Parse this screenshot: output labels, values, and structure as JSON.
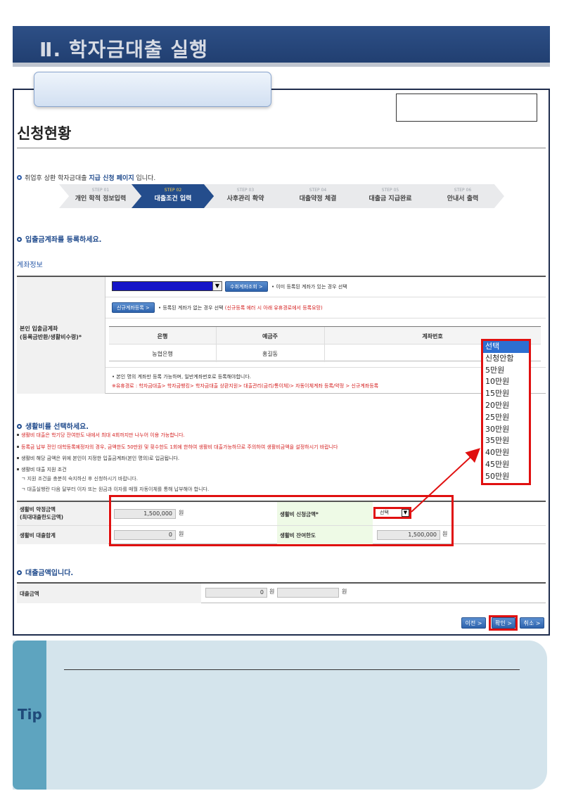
{
  "banner": {
    "title": "Ⅱ. 학자금대출 실행"
  },
  "page_title": "신청현황",
  "notice": {
    "prefix": "취업후 상환 학자금대출 ",
    "bold": "지급 신청 페이지",
    "suffix": " 입니다."
  },
  "steps": [
    {
      "num": "STEP 01",
      "label": "개인 학적 정보입력"
    },
    {
      "num": "STEP 02",
      "label": "대출조건 입력"
    },
    {
      "num": "STEP 03",
      "label": "사후관리 확약"
    },
    {
      "num": "STEP 04",
      "label": "대출약정 체결"
    },
    {
      "num": "STEP 05",
      "label": "대출금 지급완료"
    },
    {
      "num": "STEP 06",
      "label": "안내서 출력"
    }
  ],
  "account_section": {
    "heading": "입출금계좌를 등록하세요.",
    "subheading": "계좌정보",
    "row_label": "본인 입출금계좌\n(등록금반환/생활비수령)*",
    "lookup_button": "수취계좌조회 >",
    "lookup_note": "• 이미 등록된 계좌가 있는 경우 선택",
    "new_button": "신규계좌등록 >",
    "new_note_prefix": "• 등록된 계좌가 없는 경우 선택 ",
    "new_note_red": "(신규등록 에러 시 아래 유휴경로에서 등록요망)",
    "bank_table": {
      "headers": [
        "은행",
        "예금주",
        "계좌번호"
      ],
      "row": [
        "농협은행",
        "홍길동",
        ""
      ]
    },
    "foot_note": "• 본인 명의 계좌만 등록 가능하며, 일반계좌번호로 등록해야합니다.",
    "foot_note_red": "※유휴경로 : 학자금대출> 학자금뱅킹> 학자금대출 상환지원> 대출관리(금리/통이체)> 자동이체계좌 등록/약정 > 신규계좌등록"
  },
  "dropdown": {
    "options": [
      "선택",
      "신청안함",
      "5만원",
      "10만원",
      "15만원",
      "20만원",
      "25만원",
      "30만원",
      "35만원",
      "40만원",
      "45만원",
      "50만원"
    ],
    "selected": "선택"
  },
  "living_section": {
    "heading": "생활비를 선택하세요.",
    "notes": [
      {
        "text": "생활비 대출은 학기당 잔여한도 내에서 최대 4회까지만 나누어 이용 가능합니다.",
        "color": "red"
      },
      {
        "text": "등록금 납부 전인 대학등록예정자의 경우, 금액한도 50만원 및 횟수한도 1회에 한하여 생활비 대출가능하므로 주의하여 생활비금액을 설정하시기 바랍니다",
        "color": "red"
      },
      {
        "text": "생활비 해당 금액은 위에 본인이 지정한 입출금계좌(본인 명의)로 입금됩니다.",
        "color": "dark"
      },
      {
        "text": "생활비 대출 지원 조건",
        "color": "dark"
      },
      {
        "text": "ㄱ 지원 조건을 충분히 숙지하신 후 신청하시기 바랍니다.",
        "color": "dark"
      },
      {
        "text": "ㄱ 대출실행란 다음 달부터 이자 또는 원금과 이자를 매월 자동이체를 통해 납부해야 합니다.",
        "color": "dark"
      }
    ],
    "row1_label": "생활비 약정금액\n(최대대출한도금액)",
    "row1_value": "1,500,000",
    "row1_unit": "원",
    "apply_label": "생활비 신청금액*",
    "select_value": "선택",
    "row2_label": "생활비 대출합계",
    "row2_value": "0",
    "row2_unit": "원",
    "remain_label": "생활비 잔여한도",
    "remain_value": "1,500,000",
    "remain_unit": "원"
  },
  "loan_section": {
    "heading": "대출금액입니다.",
    "label": "대출금액",
    "value": "0",
    "unit1": "원",
    "unit2": "원"
  },
  "buttons": {
    "prev": "이전 >",
    "confirm": "확인 >",
    "cancel": "취소 >"
  },
  "tip": {
    "label": "Tip"
  },
  "colors": {
    "banner": "#213f71",
    "accent": "#2e63ad",
    "highlight": "#e01010",
    "tip_bg": "#d4e4ec",
    "tip_tab": "#5ea4bf"
  }
}
